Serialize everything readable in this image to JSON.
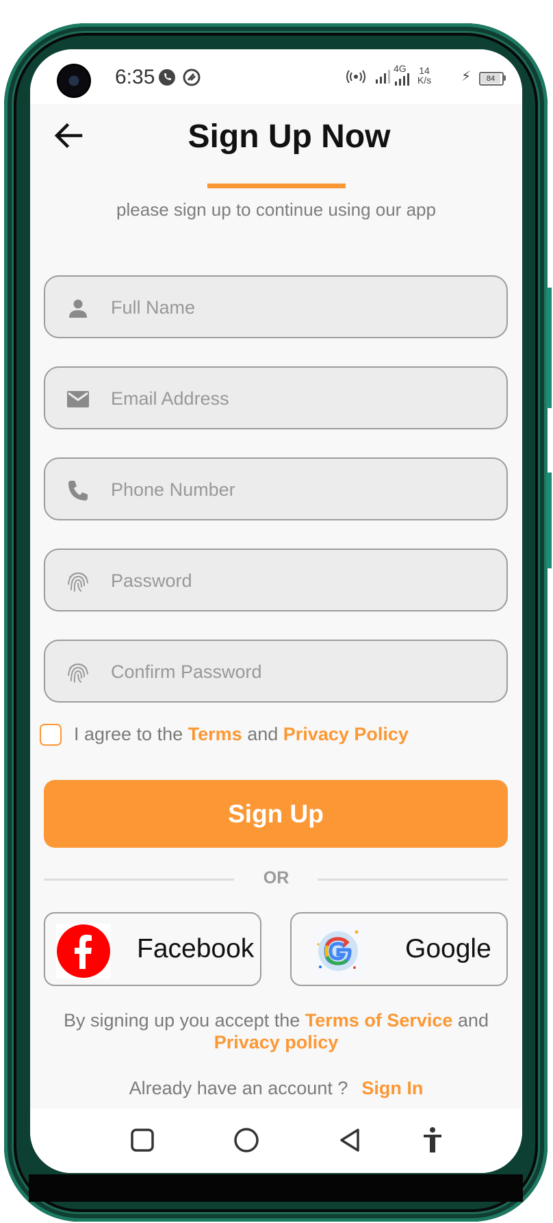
{
  "status_bar": {
    "time": "6:35",
    "network": "4G",
    "speed_value": "14",
    "speed_unit": "K/s",
    "battery": "84"
  },
  "header": {
    "title": "Sign Up Now",
    "subtitle": "please sign up to continue using our app"
  },
  "form": {
    "fields": [
      {
        "placeholder": "Full Name",
        "value": "",
        "icon": "person-icon"
      },
      {
        "placeholder": "Email Address",
        "value": "",
        "icon": "mail-icon"
      },
      {
        "placeholder": "Phone Number",
        "value": "",
        "icon": "phone-icon"
      },
      {
        "placeholder": "Password",
        "value": "",
        "icon": "fingerprint-icon"
      },
      {
        "placeholder": "Confirm Password",
        "value": "",
        "icon": "fingerprint-icon"
      }
    ],
    "agree": {
      "checked": false,
      "prefix": "I agree to the",
      "terms": "Terms",
      "and": "and",
      "privacy": "Privacy Policy"
    },
    "submit_label": "Sign Up"
  },
  "divider": {
    "label": "OR"
  },
  "social": {
    "facebook_label": "Facebook",
    "google_label": "Google"
  },
  "footer": {
    "note_prefix": "By signing up you accept the",
    "terms_of_service": "Terms of Service",
    "and": "and",
    "privacy_policy": "Privacy policy",
    "already": "Already have an account ?",
    "sign_in": "Sign In"
  },
  "colors": {
    "accent": "#fb9835",
    "facebook": "#ff0000",
    "frame": "#0d3f33"
  },
  "nav_bar": [
    "square-icon",
    "circle-icon",
    "triangle-back-icon",
    "accessibility-icon"
  ]
}
